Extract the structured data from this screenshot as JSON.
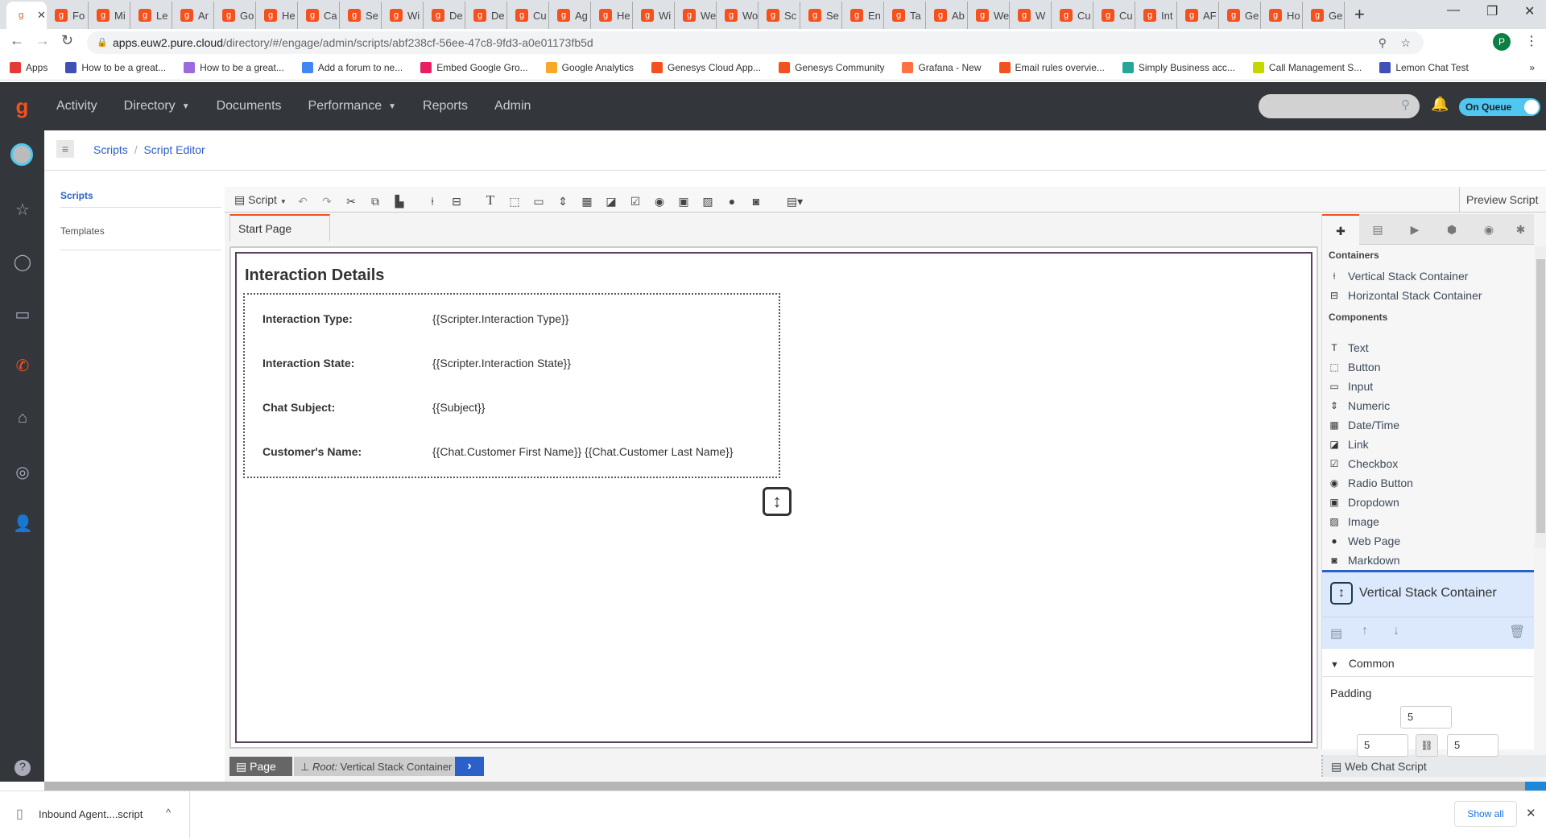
{
  "browser": {
    "tabs": [
      "",
      "Fo",
      "Mi",
      "Le",
      "Ar",
      "Go",
      "He",
      "Ca",
      "Se",
      "Wi",
      "De",
      "De",
      "Cu",
      "Ag",
      "He",
      "Wi",
      "We",
      "Wo",
      "Sc",
      "Se",
      "En",
      "Ta",
      "Ab",
      "We",
      "W",
      "Cu",
      "Cu",
      "Int",
      "AF",
      "Ge",
      "Ho",
      "Ge"
    ],
    "new_tab": "+",
    "url_host": "apps.euw2.pure.cloud",
    "url_path": "/directory/#/engage/admin/scripts/abf238cf-56ee-47c8-9fd3-a0e01173fb5d",
    "profile_initial": "P",
    "bookmarks": [
      "Apps",
      "How to be a great...",
      "How to be a great...",
      "Add a forum to ne...",
      "Embed Google Gro...",
      "Google Analytics",
      "Genesys Cloud App...",
      "Genesys Community",
      "Grafana - New",
      "Email rules overvie...",
      "Simply Business acc...",
      "Call Management S...",
      "Lemon Chat Test"
    ],
    "bookmarks_more": "»"
  },
  "topnav": {
    "items": [
      "Activity",
      "Directory",
      "Documents",
      "Performance",
      "Reports",
      "Admin"
    ],
    "status": "On Queue",
    "search_placeholder": ""
  },
  "breadcrumb": {
    "items": [
      "Scripts",
      "Script Editor"
    ],
    "sep": "/"
  },
  "subnav": {
    "items": [
      "Scripts",
      "Templates"
    ]
  },
  "toolbar": {
    "script_menu": "Script",
    "preview": "Preview Script"
  },
  "page_tab": "Start Page",
  "canvas": {
    "title": "Interaction Details",
    "rows": [
      {
        "label": "Interaction Type:",
        "value": "{{Scripter.Interaction Type}}"
      },
      {
        "label": "Interaction State:",
        "value": "{{Scripter.Interaction State}}"
      },
      {
        "label": "Chat Subject:",
        "value": "{{Subject}}"
      },
      {
        "label": "Customer's Name:",
        "value": "{{Chat.Customer First Name}} {{Chat.Customer Last Name}}"
      }
    ]
  },
  "panel": {
    "containers_heading": "Containers",
    "containers": [
      "Vertical Stack Container",
      "Horizontal Stack Container"
    ],
    "components_heading": "Components",
    "components": [
      "Text",
      "Button",
      "Input",
      "Numeric",
      "Date/Time",
      "Link",
      "Checkbox",
      "Radio Button",
      "Dropdown",
      "Image",
      "Web Page",
      "Markdown"
    ],
    "selected": "Vertical Stack Container",
    "common": "Common",
    "padding_label": "Padding",
    "padding": {
      "top": "5",
      "left": "5",
      "right": "5"
    }
  },
  "statusbar": {
    "page": "Page",
    "root_label": "Root:",
    "root_value": "Vertical Stack Container",
    "script_name": "Web Chat Script"
  },
  "download": {
    "file": "Inbound Agent....script",
    "show_all": "Show all"
  },
  "colors": {
    "accent": "#f4511e",
    "nav": "#33373b",
    "link": "#2a60c8",
    "queue": "#4fc7f0",
    "canvas_border": "#5a3f5e"
  }
}
